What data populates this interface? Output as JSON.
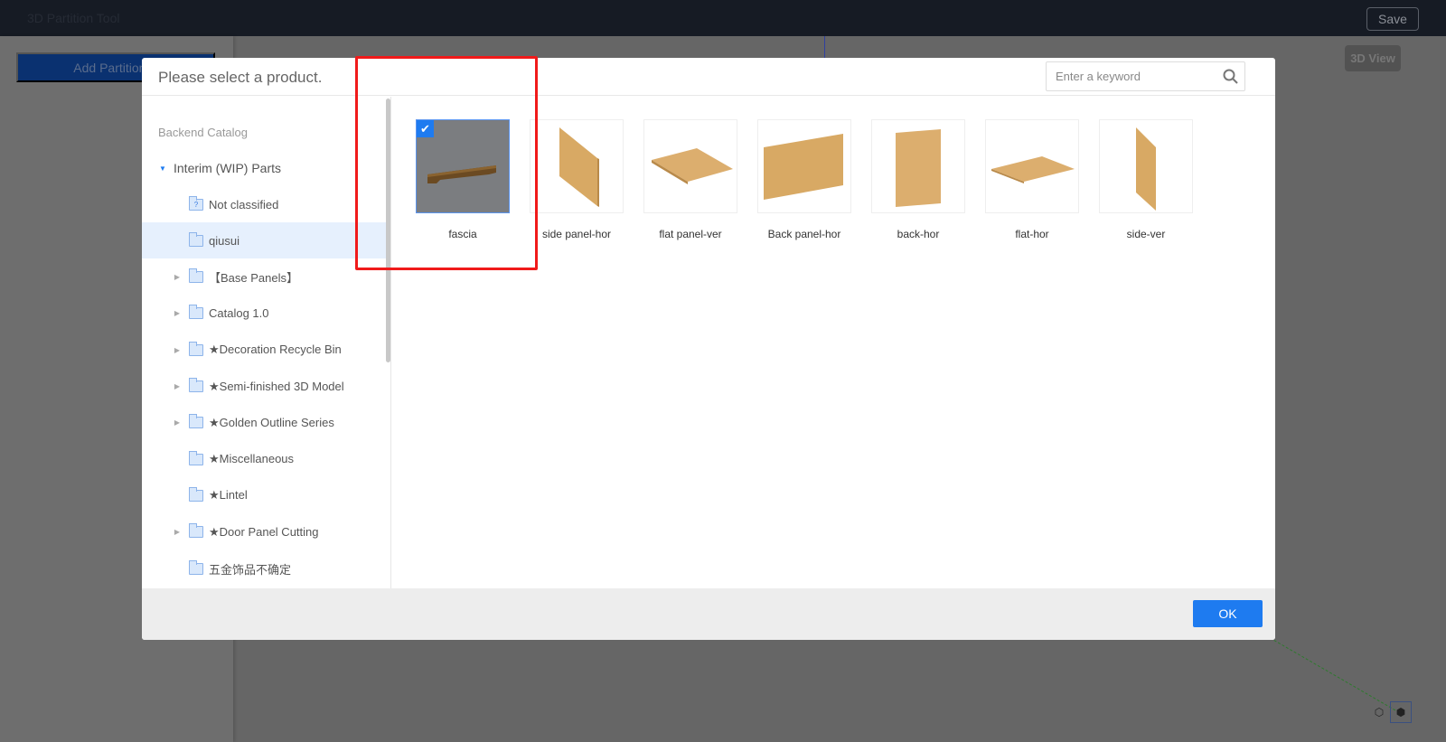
{
  "app": {
    "title": "3D Partition Tool",
    "save_label": "Save",
    "add_partition_label": "Add Partition P",
    "view_3d_label": "3D View"
  },
  "modal": {
    "title": "Please select a product.",
    "search_placeholder": "Enter a keyword",
    "ok_label": "OK",
    "tree": {
      "header": "Backend Catalog",
      "root": "Interim (WIP) Parts",
      "items": [
        {
          "label": "Not classified",
          "expandable": false,
          "icon": "unknown-folder-icon"
        },
        {
          "label": "qiusui",
          "expandable": false,
          "selected": true
        },
        {
          "label": "【Base Panels】",
          "expandable": true
        },
        {
          "label": "Catalog 1.0",
          "expandable": true
        },
        {
          "label": "★Decoration Recycle Bin",
          "expandable": true
        },
        {
          "label": "★Semi-finished 3D Model",
          "expandable": true
        },
        {
          "label": "★Golden Outline Series",
          "expandable": true
        },
        {
          "label": "★Miscellaneous",
          "expandable": false
        },
        {
          "label": "★Lintel",
          "expandable": false
        },
        {
          "label": "★Door Panel Cutting",
          "expandable": true
        },
        {
          "label": "五金饰品不确定",
          "expandable": false
        }
      ]
    },
    "products": [
      {
        "label": "fascia",
        "selected": true
      },
      {
        "label": "side panel-hor"
      },
      {
        "label": "flat panel-ver"
      },
      {
        "label": "Back panel-hor"
      },
      {
        "label": "back-hor"
      },
      {
        "label": "flat-hor"
      },
      {
        "label": "side-ver"
      }
    ]
  },
  "colors": {
    "accent": "#1e7bf0",
    "annotation": "#f01a1a",
    "wood": "#dcae6e"
  }
}
